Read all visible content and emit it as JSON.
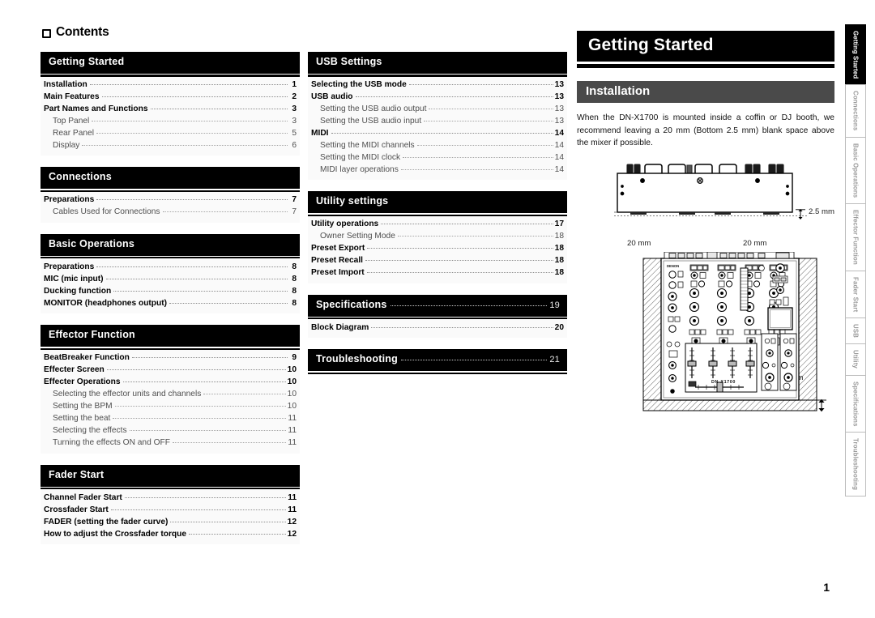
{
  "contents": {
    "title": "Contents",
    "icon": "book-icon",
    "sections": [
      {
        "heading": "Getting Started",
        "entries": [
          {
            "level": 1,
            "text": "Installation",
            "page": "1"
          },
          {
            "level": 1,
            "text": "Main Features",
            "page": "2"
          },
          {
            "level": 1,
            "text": "Part Names and Functions",
            "page": "3"
          },
          {
            "level": 2,
            "text": "Top Panel",
            "page": "3"
          },
          {
            "level": 2,
            "text": "Rear Panel",
            "page": "5"
          },
          {
            "level": 2,
            "text": "Display",
            "page": "6"
          }
        ]
      },
      {
        "heading": "Connections",
        "entries": [
          {
            "level": 1,
            "text": "Preparations",
            "page": "7"
          },
          {
            "level": 2,
            "text": "Cables Used for Connections",
            "page": "7"
          }
        ]
      },
      {
        "heading": "Basic Operations",
        "entries": [
          {
            "level": 1,
            "text": "Preparations",
            "page": "8"
          },
          {
            "level": 1,
            "text": "MIC (mic input)",
            "page": "8"
          },
          {
            "level": 1,
            "text": "Ducking function",
            "page": "8"
          },
          {
            "level": 1,
            "text": "MONITOR (headphones output)",
            "page": "8"
          }
        ]
      },
      {
        "heading": "Effector Function",
        "entries": [
          {
            "level": 1,
            "text": "BeatBreaker Function",
            "page": "9"
          },
          {
            "level": 1,
            "text": "Effecter Screen",
            "page": "10"
          },
          {
            "level": 1,
            "text": "Effecter Operations",
            "page": "10"
          },
          {
            "level": 2,
            "text": "Selecting the effector units and channels",
            "page": "10"
          },
          {
            "level": 2,
            "text": "Setting the BPM",
            "page": "10"
          },
          {
            "level": 2,
            "text": "Setting the beat",
            "page": "11"
          },
          {
            "level": 2,
            "text": "Selecting the effects",
            "page": "11"
          },
          {
            "level": 2,
            "text": "Turning the effects ON and OFF",
            "page": "11"
          }
        ]
      },
      {
        "heading": "Fader Start",
        "entries": [
          {
            "level": 1,
            "text": "Channel Fader Start",
            "page": "11"
          },
          {
            "level": 1,
            "text": "Crossfader Start",
            "page": "11"
          },
          {
            "level": 1,
            "text": "FADER (setting the fader curve)",
            "page": "12"
          },
          {
            "level": 1,
            "text": "How to adjust the Crossfader torque",
            "page": "12"
          }
        ]
      },
      {
        "heading": "USB Settings",
        "entries": [
          {
            "level": 1,
            "text": "Selecting the USB mode",
            "page": "13"
          },
          {
            "level": 1,
            "text": "USB audio",
            "page": "13"
          },
          {
            "level": 2,
            "text": "Setting the USB audio output",
            "page": "13"
          },
          {
            "level": 2,
            "text": "Setting the USB audio input",
            "page": "13"
          },
          {
            "level": 1,
            "text": "MIDI",
            "page": "14"
          },
          {
            "level": 2,
            "text": "Setting the MIDI channels",
            "page": "14"
          },
          {
            "level": 2,
            "text": "Setting the MIDI clock",
            "page": "14"
          },
          {
            "level": 2,
            "text": "MIDI layer operations",
            "page": "14"
          }
        ]
      },
      {
        "heading": "Utility settings",
        "entries": [
          {
            "level": 1,
            "text": "Utility operations",
            "page": "17"
          },
          {
            "level": 2,
            "text": "Owner Setting Mode",
            "page": "18"
          },
          {
            "level": 1,
            "text": "Preset Export",
            "page": "18"
          },
          {
            "level": 1,
            "text": "Preset Recall",
            "page": "18"
          },
          {
            "level": 1,
            "text": "Preset Import",
            "page": "18"
          }
        ]
      },
      {
        "heading": "Specifications",
        "heading_page": "19",
        "entries": [
          {
            "level": 1,
            "text": "Block Diagram",
            "page": "20"
          }
        ]
      },
      {
        "heading": "Troubleshooting",
        "heading_page": "21",
        "entries": []
      }
    ]
  },
  "chapter": {
    "title": "Getting Started",
    "section_title": "Installation",
    "body": "When the DN-X1700 is mounted inside a coffin or DJ booth, we recommend leaving a 20 mm (Bottom 2.5 mm) blank space above the mixer if possible."
  },
  "diagram": {
    "device_label": "DN-X1700",
    "brand_label": "DENON",
    "dimensions": {
      "bottom_clearance": "2.5 mm",
      "left_clearance": "20 mm",
      "right_clearance": "20 mm",
      "under_clearance": "20 mm"
    }
  },
  "side_tabs": [
    {
      "label": "Getting Started",
      "active": true
    },
    {
      "label": "Connections",
      "active": false
    },
    {
      "label": "Basic Operations",
      "active": false
    },
    {
      "label": "Effector Function",
      "active": false
    },
    {
      "label": "Fader Start",
      "active": false
    },
    {
      "label": "USB",
      "active": false
    },
    {
      "label": "Utility",
      "active": false
    },
    {
      "label": "Specifications",
      "active": false
    },
    {
      "label": "Troubleshooting",
      "active": false
    }
  ],
  "footer": {
    "page_number": "1"
  }
}
